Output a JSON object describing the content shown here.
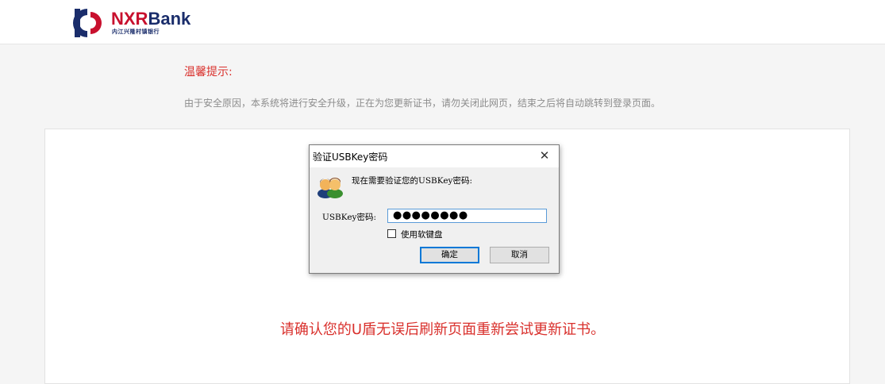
{
  "header": {
    "logo_brand_a": "NXR",
    "logo_brand_b": "Bank",
    "logo_subtitle": "内江兴隆村镇银行"
  },
  "notice": {
    "title": "温馨提示:",
    "body": "由于安全原因，本系统将进行安全升级，正在为您更新证书，请勿关闭此网页，结束之后将自动跳转到登录页面。"
  },
  "dialog": {
    "title": "验证USBKey密码",
    "close_glyph": "✕",
    "prompt": "现在需要验证您的USBKey密码:",
    "password_label": "USBKey密码:",
    "password_value": "●●●●●●●●",
    "soft_keyboard_label": "使用软键盘",
    "soft_keyboard_checked": false,
    "ok_label": "确定",
    "cancel_label": "取消",
    "icon": "users-icon"
  },
  "message": {
    "retry": "请确认您的U盾无误后刷新页面重新尝试更新证书。"
  },
  "colors": {
    "accent_red": "#d9302c",
    "brand_red": "#c8102e",
    "brand_blue": "#1a2d6b",
    "focus_blue": "#0078d7"
  }
}
